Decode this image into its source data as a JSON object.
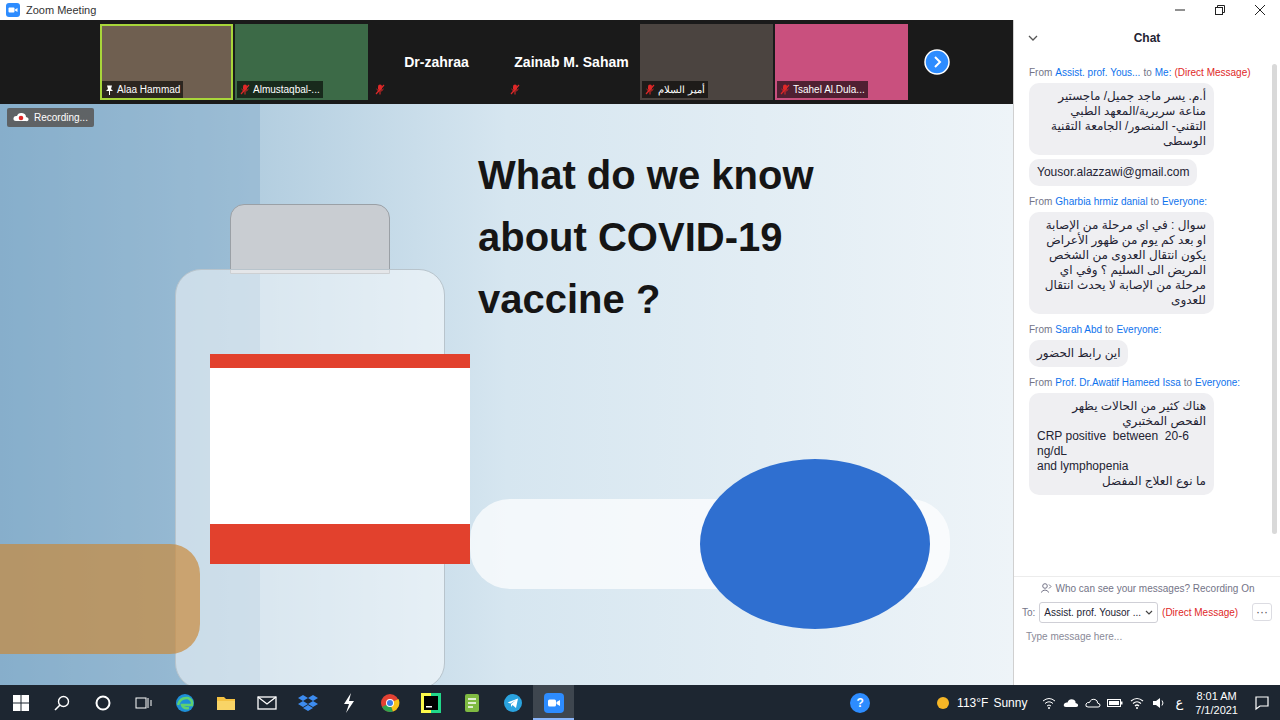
{
  "window": {
    "title": "Zoom Meeting"
  },
  "gallery": {
    "participants": [
      {
        "name": "Alaa Hammad",
        "kind": "video",
        "muted": false,
        "pinned": true,
        "speaking": true,
        "color": "#6f5f50"
      },
      {
        "name": "Almustaqbal-...",
        "kind": "video",
        "muted": true,
        "pinned": false,
        "speaking": false,
        "color": "#3c6a47"
      },
      {
        "name": "Dr-zahraa",
        "kind": "name",
        "muted": true,
        "pinned": false,
        "speaking": false,
        "color": "#1a1a1a"
      },
      {
        "name": "Zainab M. Saham",
        "kind": "name",
        "muted": true,
        "pinned": false,
        "speaking": false,
        "color": "#1a1a1a"
      },
      {
        "name": "أمير السلام",
        "kind": "video",
        "muted": true,
        "pinned": false,
        "speaking": false,
        "color": "#4b4440"
      },
      {
        "name": "Tsahel Al.Dula...",
        "kind": "video",
        "muted": true,
        "pinned": false,
        "speaking": false,
        "color": "#c9507e"
      }
    ]
  },
  "recording": {
    "label": "Recording..."
  },
  "slide": {
    "title": "What do we know about COVID-19 vaccine ?"
  },
  "chat": {
    "title": "Chat",
    "messages": [
      {
        "from_label": "From",
        "sender": "Assist. prof. Yous...",
        "to_label": "to",
        "recipient": "Me:",
        "note": "(Direct Message)",
        "bubbles": [
          [
            "أ.م. يسر ماجد جميل/ ماجستير مناعة سريرية/المعهد الطبي التقني- المنصور/ الجامعة التقنية الوسطى"
          ],
          [
            "Yousor.alazzawi@gmail.com"
          ]
        ]
      },
      {
        "from_label": "From",
        "sender": "Gharbia hrmiz danial",
        "to_label": "to",
        "recipient": "Everyone:",
        "bubbles": [
          [
            "سوال : في اي مرحلة من الإصابة او بعد كم يوم من ظهور الأعراض يكون انتقال العدوى من الشخص المريض الى السليم ؟ وفي اي مرحلة من الإصابة لا يحدث انتقال للعدوى"
          ]
        ]
      },
      {
        "from_label": "From",
        "sender": "Sarah Abd",
        "to_label": "to",
        "recipient": "Everyone:",
        "bubbles": [
          [
            "اين رابط الحضور"
          ]
        ]
      },
      {
        "from_label": "From",
        "sender": "Prof. Dr.Awatif Hameed Issa",
        "to_label": "to",
        "recipient": "Everyone:",
        "bubbles": [
          [
            "هناك كثير من الحالات يظهر الفحص المختبري",
            "CRP positive  between  20-6 ng/dL",
            "and lymphopenia",
            "ما نوع العلاج المفضل"
          ]
        ]
      }
    ],
    "privacy_note": "Who can see your messages? Recording On",
    "to_label": "To:",
    "recipient": "Assist. prof. Yousor ...",
    "recipient_note": "(Direct Message)",
    "more": "···",
    "placeholder": "Type message here..."
  },
  "taskbar": {
    "apps": [
      {
        "kind": "windows",
        "selected": false
      },
      {
        "kind": "search",
        "selected": false
      },
      {
        "kind": "cortana",
        "selected": false
      },
      {
        "kind": "taskview",
        "selected": false
      },
      {
        "kind": "edge",
        "selected": false
      },
      {
        "kind": "explorer",
        "selected": false
      },
      {
        "kind": "mail",
        "selected": false
      },
      {
        "kind": "dropbox",
        "selected": false
      },
      {
        "kind": "tool",
        "selected": false
      },
      {
        "kind": "chrome",
        "selected": false
      },
      {
        "kind": "pycharm",
        "selected": false
      },
      {
        "kind": "notepad",
        "selected": false
      },
      {
        "kind": "telegram",
        "selected": false
      },
      {
        "kind": "zoom",
        "selected": true
      }
    ],
    "help": "?",
    "weather": {
      "temp": "113°F",
      "condition": "Sunny"
    },
    "language": "ع",
    "time": "8:01 AM",
    "date": "7/1/2021"
  }
}
